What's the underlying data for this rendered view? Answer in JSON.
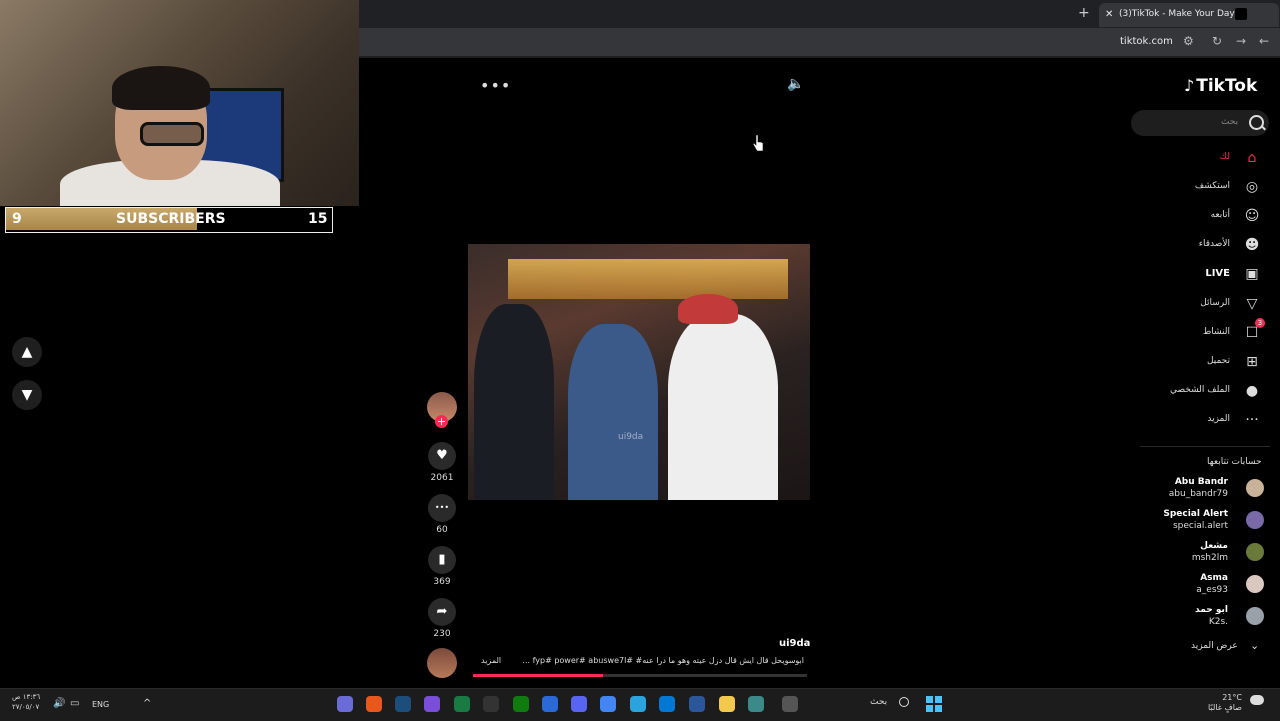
{
  "browser": {
    "tab_title": "(3)TikTok - Make Your Day",
    "url": "tiktok.com",
    "new_tab_glyph": "+",
    "close_tab_glyph": "✕"
  },
  "overlay": {
    "sub_left": "9",
    "sub_label": "SUBSCRIBERS",
    "sub_right": "15",
    "subscriber_progress": 0.59
  },
  "player": {
    "more_glyph": "•••",
    "volume_glyph": "🔈",
    "nav_up": "▲",
    "nav_down": "▼",
    "video_watermark": "ui9da",
    "progress": 0.39
  },
  "actions": {
    "likes": "2061",
    "comments": "60",
    "saves": "369",
    "shares": "230",
    "like_glyph": "♥",
    "comment_glyph": "•••",
    "save_glyph": "▮",
    "share_glyph": "➦",
    "follow_glyph": "+"
  },
  "caption": {
    "author": "ui9da",
    "text": "... fyp# power# abuswe7l# #ابوسويحل قال ايش قال دزل عيته وهو ما درا عنه",
    "more": "المزيد"
  },
  "sidebar": {
    "logo": "TikTok",
    "logo_glyph": "♪",
    "search_placeholder": "بحث",
    "nav": [
      {
        "label": "لك",
        "icon": "home-icon",
        "glyph": "⌂"
      },
      {
        "label": "استكشف",
        "icon": "compass-icon",
        "glyph": "◎"
      },
      {
        "label": "أتابعه",
        "icon": "following-icon",
        "glyph": "☺"
      },
      {
        "label": "الأصدقاء",
        "icon": "friends-icon",
        "glyph": "☻"
      },
      {
        "label": "LIVE",
        "icon": "live-icon",
        "glyph": "▣"
      },
      {
        "label": "الرسائل",
        "icon": "messages-icon",
        "glyph": "▽"
      },
      {
        "label": "النشاط",
        "icon": "activity-icon",
        "glyph": "☐",
        "badge": "3"
      },
      {
        "label": "تحميل",
        "icon": "upload-icon",
        "glyph": "⊞"
      },
      {
        "label": "الملف الشخصي",
        "icon": "profile-icon",
        "glyph": "●"
      },
      {
        "label": "المزيد",
        "icon": "more-icon",
        "glyph": "···"
      }
    ],
    "following_title": "حسابات تتابعها",
    "accounts": [
      {
        "name": "Abu Bandr",
        "handle": "abu_bandr79",
        "color": "#c8b29a"
      },
      {
        "name": "Special Alert",
        "handle": "special.alert",
        "color": "#7a6aa8"
      },
      {
        "name": "مشعل",
        "handle": "msh2lm",
        "color": "#6a7a3a"
      },
      {
        "name": "Asma",
        "handle": "a_es93",
        "color": "#d8c8c0"
      },
      {
        "name": "ابو حمد",
        "handle": "K2s.",
        "color": "#9aa0a8"
      }
    ],
    "see_more": "عرض المزيد",
    "see_more_glyph": "⌄"
  },
  "taskbar": {
    "time": "١٣:٣٦ ص",
    "date": "٢٧/٠٥/٠٧",
    "lang": "ENG",
    "search": "بحث",
    "temp": "21°C",
    "weather": "صافٍ غالبًا",
    "tray_glyph": "^"
  },
  "colors": {
    "accent": "#fe2c55",
    "gold": "#c8a96a"
  }
}
